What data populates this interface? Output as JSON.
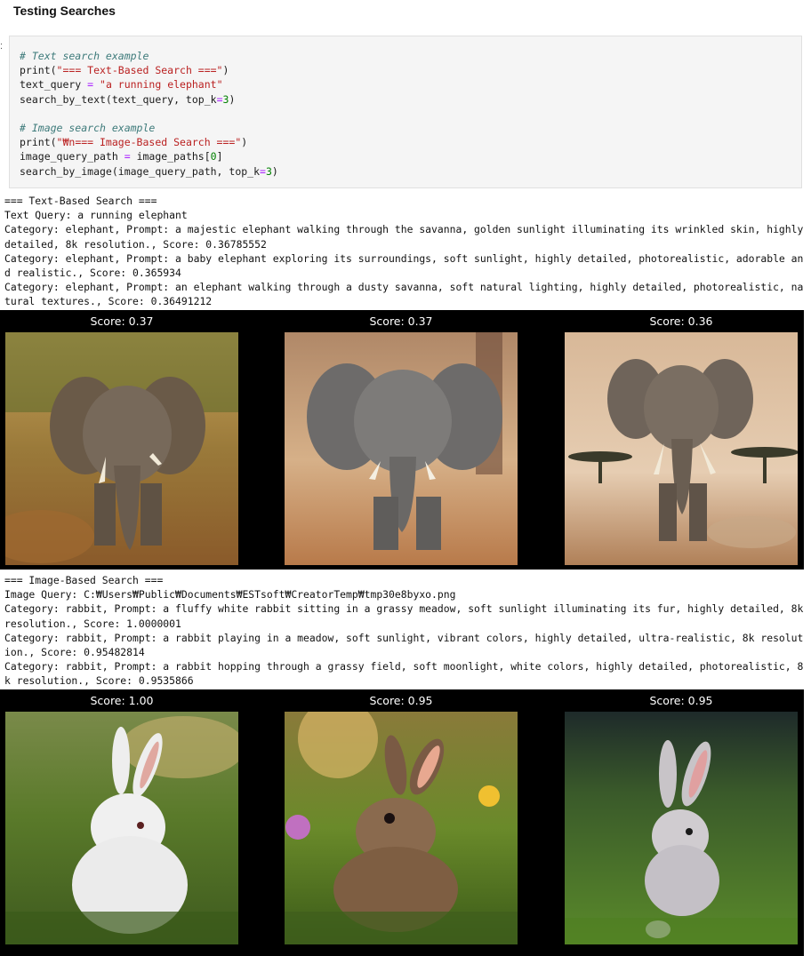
{
  "section_title": "Testing Searches",
  "cell_marker": ":",
  "code": {
    "comment1": "# Text search example",
    "print1_fn": "print(",
    "print1_str": "\"=== Text-Based Search ===\"",
    "print1_close": ")",
    "line3_var": "text_query ",
    "line3_eq": "=",
    "line3_str": " \"a running elephant\"",
    "line4_a": "search_by_text(text_query, top_k",
    "line4_eq": "=",
    "line4_num": "3",
    "line4_close": ")",
    "comment2": "# Image search example",
    "print2_fn": "print(",
    "print2_str": "\"₩n=== Image-Based Search ===\"",
    "print2_close": ")",
    "line7_var": "image_query_path ",
    "line7_eq": "=",
    "line7_rest": " image_paths[",
    "line7_num": "0",
    "line7_close": "]",
    "line8_a": "search_by_image(image_query_path, top_k",
    "line8_eq": "=",
    "line8_num": "3",
    "line8_close": ")"
  },
  "text_output": {
    "header": "=== Text-Based Search ===",
    "query": "Text Query: a running elephant",
    "results": [
      "Category: elephant, Prompt: a majestic elephant walking through the savanna, golden sunlight illuminating its wrinkled skin, highly detailed, 8k resolution., Score: 0.36785552",
      "Category: elephant, Prompt: a baby elephant exploring its surroundings, soft sunlight, highly detailed, photorealistic, adorable and realistic., Score: 0.365934",
      "Category: elephant, Prompt: an elephant walking through a dusty savanna, soft natural lighting, highly detailed, photorealistic, natural textures., Score: 0.36491212"
    ],
    "scores": [
      "Score: 0.37",
      "Score: 0.37",
      "Score: 0.36"
    ]
  },
  "image_output": {
    "header": "=== Image-Based Search ===",
    "query": "Image Query: C:₩Users₩Public₩Documents₩ESTsoft₩CreatorTemp₩tmp30e8byxo.png",
    "results": [
      "Category: rabbit, Prompt: a fluffy white rabbit sitting in a grassy meadow, soft sunlight illuminating its fur, highly detailed, 8k resolution., Score: 1.0000001",
      "Category: rabbit, Prompt: a rabbit playing in a meadow, soft sunlight, vibrant colors, highly detailed, ultra-realistic, 8k resolution., Score: 0.95482814",
      "Category: rabbit, Prompt: a rabbit hopping through a grassy field, soft moonlight, white colors, highly detailed, photorealistic, 8k resolution., Score: 0.9535866"
    ],
    "scores": [
      "Score: 1.00",
      "Score: 0.95",
      "Score: 0.95"
    ]
  },
  "colors": {
    "comment": "#3d7a7a",
    "string": "#ba2121",
    "operator": "#aa22ff",
    "number": "#008000",
    "figure_bg": "#000000"
  }
}
